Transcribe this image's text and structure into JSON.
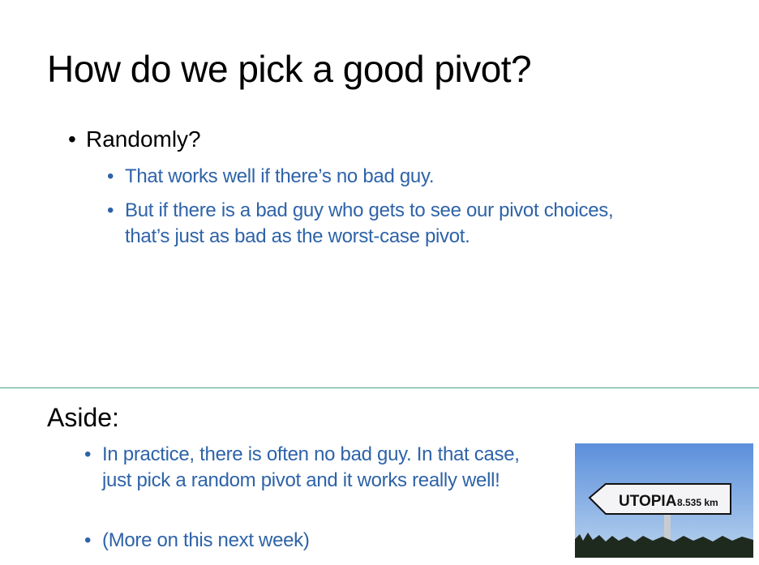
{
  "title": "How do we pick a good pivot?",
  "bullet_char": "•",
  "main": {
    "bullet": "Randomly?",
    "sub": [
      "That works well if there’s no bad guy.",
      "But if there is a bad guy who gets to see our pivot choices, that’s just as bad as the worst-case pivot."
    ]
  },
  "aside": {
    "heading": "Aside:",
    "sub": [
      "In practice, there is often no bad guy.  In that case, just pick a random pivot and it works really well!",
      "(More on this next week)"
    ]
  },
  "image": {
    "sign_text": "UTOPIA",
    "sign_distance": "8.535 km",
    "colors": {
      "sky_top": "#5b8fdc",
      "sky_bottom": "#b9d3ee",
      "accent": "#2E63A8",
      "divider": "#4aa58a"
    }
  }
}
